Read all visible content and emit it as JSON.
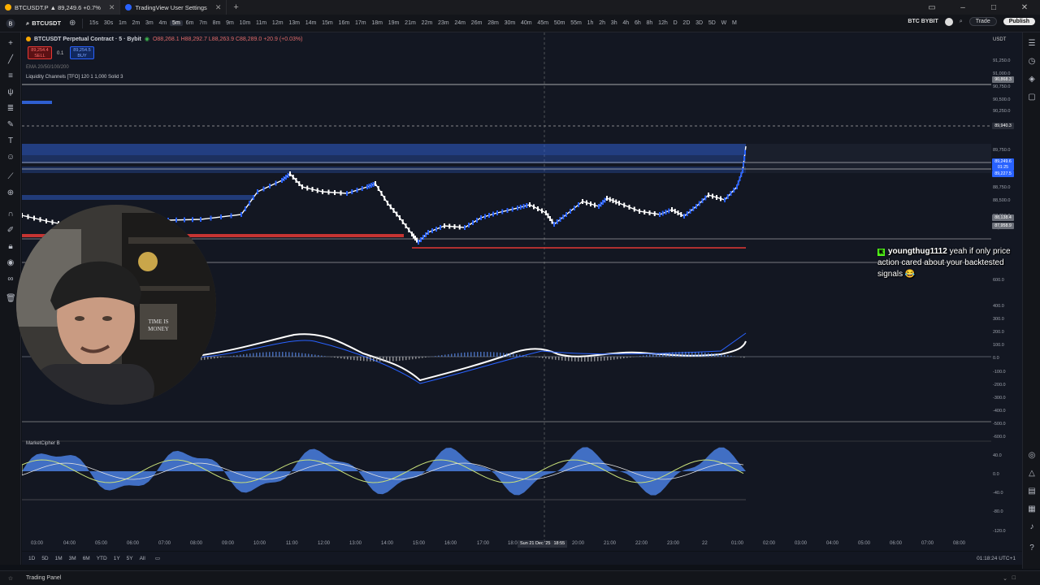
{
  "tabs": [
    {
      "label": "BTCUSDT.P ▲ 89,249.6 +0.7%",
      "active": true
    },
    {
      "label": "TradingView User Settings",
      "active": false
    }
  ],
  "toolbar": {
    "symbol": "BTCUSDT",
    "timeframes": [
      "15s",
      "30s",
      "1m",
      "2m",
      "3m",
      "4m",
      "5m",
      "6m",
      "7m",
      "8m",
      "9m",
      "10m",
      "11m",
      "12m",
      "13m",
      "14m",
      "15m",
      "16m",
      "17m",
      "18m",
      "19m",
      "21m",
      "22m",
      "23m",
      "24m",
      "26m",
      "28m",
      "30m",
      "40m",
      "45m",
      "50m",
      "55m",
      "1h",
      "2h",
      "3h",
      "4h",
      "6h",
      "8h",
      "12h",
      "D",
      "2D",
      "3D",
      "5D",
      "W",
      "M"
    ],
    "active_timeframe": "5m",
    "exchange_label": "BTC BYBIT",
    "trade_label": "Trade",
    "publish_label": "Publish"
  },
  "legend": {
    "title": "BTCUSDT Perpetual Contract · 5 · Bybit",
    "ohlc": "O88,268.1 H88,292.7 L88,263.9 C88,289.0 +20.9 (+0.03%)",
    "sell_price": "89,254.4",
    "sell_label": "SELL",
    "spread": "0.1",
    "buy_price": "89,254.5",
    "buy_label": "BUY",
    "ema_line": "EMA 20/50/100/200",
    "indicator1": "Liquidity Channels [TFO] 120 1 1,000 Solid 3",
    "indicator2": "MarketCipher B"
  },
  "price_axis": {
    "currency": "USDT",
    "labels": [
      "91,250.0",
      "91,000.0",
      "90,750.0",
      "90,500.0",
      "90,250.0",
      "89,750.0",
      "89,500.0",
      "88,750.0",
      "88,500.0",
      "87,750.0",
      "87,500.0",
      "600.0",
      "400.0",
      "300.0",
      "200.0",
      "100.0",
      "0.0",
      "-100.0",
      "-200.0",
      "-300.0",
      "-400.0",
      "-500.0",
      "-600.0",
      "40.0",
      "0.0",
      "-40.0",
      "-80.0",
      "-120.0"
    ],
    "tags": [
      {
        "text": "90,868.3",
        "color": "#6b6f78"
      },
      {
        "text": "89,940.3",
        "color": "#2a2e39"
      },
      {
        "text": "89,249.6",
        "color": "#2962ff"
      },
      {
        "text": "01:25",
        "color": "#2962ff"
      },
      {
        "text": "89,227.5",
        "color": "#2962ff"
      },
      {
        "text": "88,138.4",
        "color": "#6b6f78"
      },
      {
        "text": "87,958.9",
        "color": "#6b6f78"
      }
    ]
  },
  "time_axis": {
    "labels": [
      "03:00",
      "04:00",
      "05:00",
      "06:00",
      "07:00",
      "08:00",
      "09:00",
      "10:00",
      "11:00",
      "12:00",
      "13:00",
      "14:00",
      "15:00",
      "16:00",
      "17:00",
      "18:00",
      "20:00",
      "21:00",
      "22:00",
      "23:00",
      "22",
      "01:00",
      "02:00",
      "03:00",
      "04:00",
      "05:00",
      "06:00",
      "07:00",
      "08:00"
    ],
    "crosshair_label": "Sun 21 Dec '25",
    "crosshair_time": "18:55"
  },
  "bottom": {
    "ranges": [
      "1D",
      "5D",
      "1M",
      "3M",
      "6M",
      "YTD",
      "1Y",
      "5Y",
      "All"
    ],
    "clock": "01:18:24 UTC+1"
  },
  "status": {
    "panel_label": "Trading Panel"
  },
  "chat": {
    "username": "youngthug1112",
    "message": "yeah if only price action cared about your backtested signals 😂"
  },
  "colors": {
    "bg": "#131722",
    "accent": "#2962ff",
    "down": "#e53935",
    "macd_line": "#ffffff",
    "signal": "#2962ff"
  }
}
